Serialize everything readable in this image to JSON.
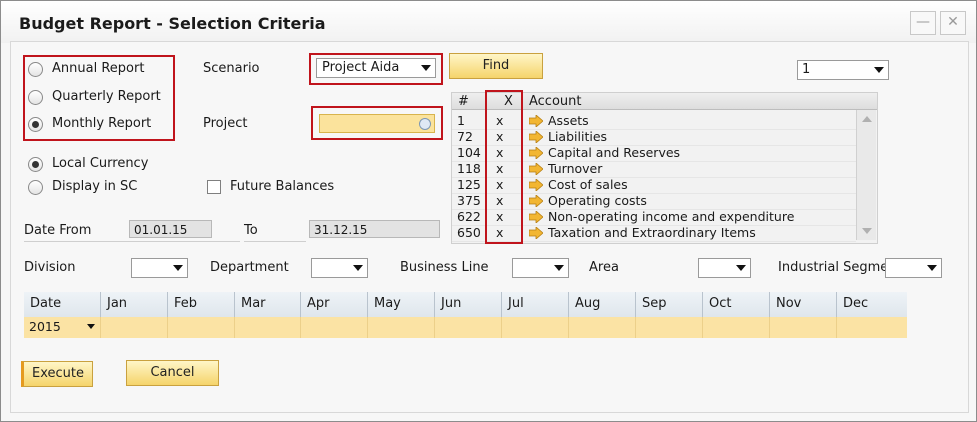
{
  "window": {
    "title": "Budget Report - Selection Criteria",
    "minimize_icon": "minimize-icon",
    "close_icon": "close-icon"
  },
  "report_type": {
    "options": [
      "Annual Report",
      "Quarterly Report",
      "Monthly Report"
    ],
    "selected": "Monthly Report"
  },
  "currency": {
    "options": [
      "Local Currency",
      "Display in SC"
    ],
    "selected": "Local Currency"
  },
  "future_balances": {
    "label": "Future Balances",
    "checked": false
  },
  "scenario": {
    "label": "Scenario",
    "value": "Project Aida"
  },
  "project": {
    "label": "Project",
    "value": ""
  },
  "find_label": "Find",
  "page_select": "1",
  "dates": {
    "from_label": "Date From",
    "from_value": "01.01.15",
    "to_label": "To",
    "to_value": "31.12.15"
  },
  "accounts": {
    "headers": [
      "#",
      "X",
      "Account"
    ],
    "rows": [
      {
        "num": "1",
        "x": "x",
        "name": "Assets"
      },
      {
        "num": "72",
        "x": "x",
        "name": "Liabilities"
      },
      {
        "num": "104",
        "x": "x",
        "name": "Capital and Reserves"
      },
      {
        "num": "118",
        "x": "x",
        "name": "Turnover"
      },
      {
        "num": "125",
        "x": "x",
        "name": "Cost of sales"
      },
      {
        "num": "375",
        "x": "x",
        "name": "Operating costs"
      },
      {
        "num": "622",
        "x": "x",
        "name": "Non-operating income and expenditure"
      },
      {
        "num": "650",
        "x": "x",
        "name": "Taxation and Extraordinary Items"
      }
    ]
  },
  "filters": {
    "division": "Division",
    "department": "Department",
    "business_line": "Business Line",
    "area": "Area",
    "industrial_segment": "Industrial Segme"
  },
  "grid": {
    "headers": [
      "Date",
      "Jan",
      "Feb",
      "Mar",
      "Apr",
      "May",
      "Jun",
      "Jul",
      "Aug",
      "Sep",
      "Oct",
      "Nov",
      "Dec"
    ],
    "row": {
      "date": "2015"
    }
  },
  "buttons": {
    "execute": "Execute",
    "cancel": "Cancel"
  },
  "colors": {
    "highlight": "#c0141c",
    "button": "#f5d46b",
    "grid_row": "#fbe3a4"
  }
}
